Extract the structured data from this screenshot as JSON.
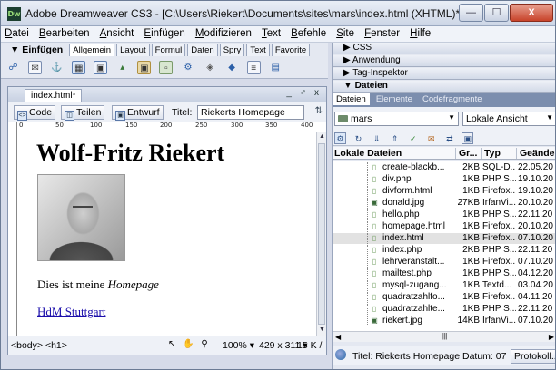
{
  "window": {
    "app_icon": "Dw",
    "title": "Adobe Dreamweaver CS3 - [C:\\Users\\Riekert\\Documents\\sites\\mars\\index.html (XHTML)*]",
    "minimize": "—",
    "maximize": "☐",
    "close": "X"
  },
  "menu": [
    "Datei",
    "Bearbeiten",
    "Ansicht",
    "Einfügen",
    "Modifizieren",
    "Text",
    "Befehle",
    "Site",
    "Fenster",
    "Hilfe"
  ],
  "insert": {
    "heading": "▼ Einfügen",
    "tabs": [
      "Allgemein",
      "Layout",
      "Formul",
      "Daten",
      "Spry",
      "Text",
      "Favorite"
    ],
    "icons": [
      "hyperlink-icon",
      "email-link-icon",
      "named-anchor-icon",
      "table-icon",
      "div-icon",
      "image-icon",
      "media-icon",
      "date-icon",
      "server-include-icon",
      "comment-icon",
      "head-icon",
      "script-icon",
      "template-icon",
      "tag-chooser-icon"
    ]
  },
  "document": {
    "tab": "index.html*",
    "controls": "_ ♂ x",
    "views": [
      "Code",
      "Teilen",
      "Entwurf"
    ],
    "title_label": "Titel:",
    "title_value": "Riekerts Homepage",
    "ruler_marks": [
      "0",
      "50",
      "100",
      "150",
      "200",
      "250",
      "300",
      "350",
      "400"
    ],
    "heading": "Wolf-Fritz Riekert",
    "paragraph_prefix": "Dies ist meine ",
    "paragraph_emphasis": "Homepage",
    "link": "HdM Stuttgart",
    "tag_selector": "<body> <h1>",
    "zoom": "100% ▾",
    "dimensions": "429 x 311 ▾",
    "file_size": "15 K /"
  },
  "panels": {
    "css": "▶ CSS",
    "anwendung": "▶ Anwendung",
    "tag_inspektor": "▶ Tag-Inspektor",
    "dateien": "▼ Dateien",
    "file_tabs": [
      "Dateien",
      "Elemente",
      "Codefragmente"
    ],
    "site": "mars",
    "view": "Lokale Ansicht",
    "columns": [
      "Lokale Dateien",
      "Gr...",
      "Typ",
      "Geände"
    ],
    "files": [
      {
        "name": "create-blackb...",
        "size": "2KB",
        "type": "SQL-D...",
        "date": "22.05.20"
      },
      {
        "name": "div.php",
        "size": "1KB",
        "type": "PHP S...",
        "date": "19.10.20"
      },
      {
        "name": "divform.html",
        "size": "1KB",
        "type": "Firefox...",
        "date": "19.10.20"
      },
      {
        "name": "donald.jpg",
        "size": "27KB",
        "type": "IrfanVi...",
        "date": "20.10.20"
      },
      {
        "name": "hello.php",
        "size": "1KB",
        "type": "PHP S...",
        "date": "22.11.20"
      },
      {
        "name": "homepage.html",
        "size": "1KB",
        "type": "Firefox...",
        "date": "20.10.20"
      },
      {
        "name": "index.html",
        "size": "1KB",
        "type": "Firefox...",
        "date": "07.10.20"
      },
      {
        "name": "index.php",
        "size": "2KB",
        "type": "PHP S...",
        "date": "22.11.20"
      },
      {
        "name": "lehrveranstalt...",
        "size": "1KB",
        "type": "Firefox...",
        "date": "07.10.20"
      },
      {
        "name": "mailtest.php",
        "size": "1KB",
        "type": "PHP S...",
        "date": "04.12.20"
      },
      {
        "name": "mysql-zugang...",
        "size": "1KB",
        "type": "Textd...",
        "date": "03.04.20"
      },
      {
        "name": "quadratzahlfo...",
        "size": "1KB",
        "type": "Firefox...",
        "date": "04.11.20"
      },
      {
        "name": "quadratzahlte...",
        "size": "1KB",
        "type": "PHP S...",
        "date": "22.11.20"
      },
      {
        "name": "riekert.jpg",
        "size": "14KB",
        "type": "IrfanVi...",
        "date": "07.10.20"
      }
    ],
    "status_text": "Titel: Riekerts Homepage  Datum: 07",
    "log_button": "Protokoll..."
  }
}
